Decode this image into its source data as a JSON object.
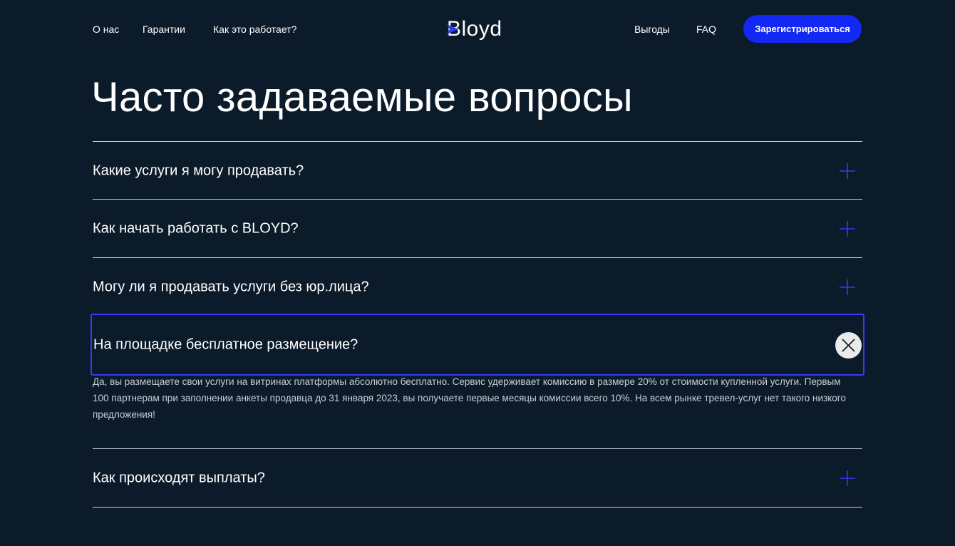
{
  "nav": {
    "left": [
      "О нас",
      "Гарантии",
      "Как это работает?"
    ],
    "right": [
      "Выгоды",
      "FAQ"
    ],
    "logo": "Bloyd",
    "cta": "Зарегистрироваться"
  },
  "page_title": "Часто задаваемые вопросы",
  "faq": {
    "items": [
      {
        "question": "Какие услуги я могу продавать?",
        "icon": "plus-icon",
        "open": false
      },
      {
        "question": "Как начать работать с BLOYD?",
        "icon": "plus-icon",
        "open": false
      },
      {
        "question": "Могу ли я продавать услуги без юр.лица?",
        "icon": "plus-icon",
        "open": false
      },
      {
        "question": "На площадке бесплатное размещение?",
        "icon": "close-icon",
        "open": true,
        "answer": "Да, вы размещаете свои услуги на витринах платформы абсолютно бесплатно. Сервис удерживает комиссию в размере 20% от стоимости купленной услуги. Первым 100 партнерам при заполнении анкеты продавца до 31 января 2023, вы получаете первые месяцы комиссии всего 10%. На всем рынке тревел-услуг нет такого низкого предложения!"
      },
      {
        "question": "Как происходят выплаты?",
        "icon": "plus-icon",
        "open": false
      }
    ]
  },
  "colors": {
    "background": "#0c1b2a",
    "accent": "#1428f5",
    "active_border": "#3a39ff",
    "plus": "#2f3cff"
  }
}
